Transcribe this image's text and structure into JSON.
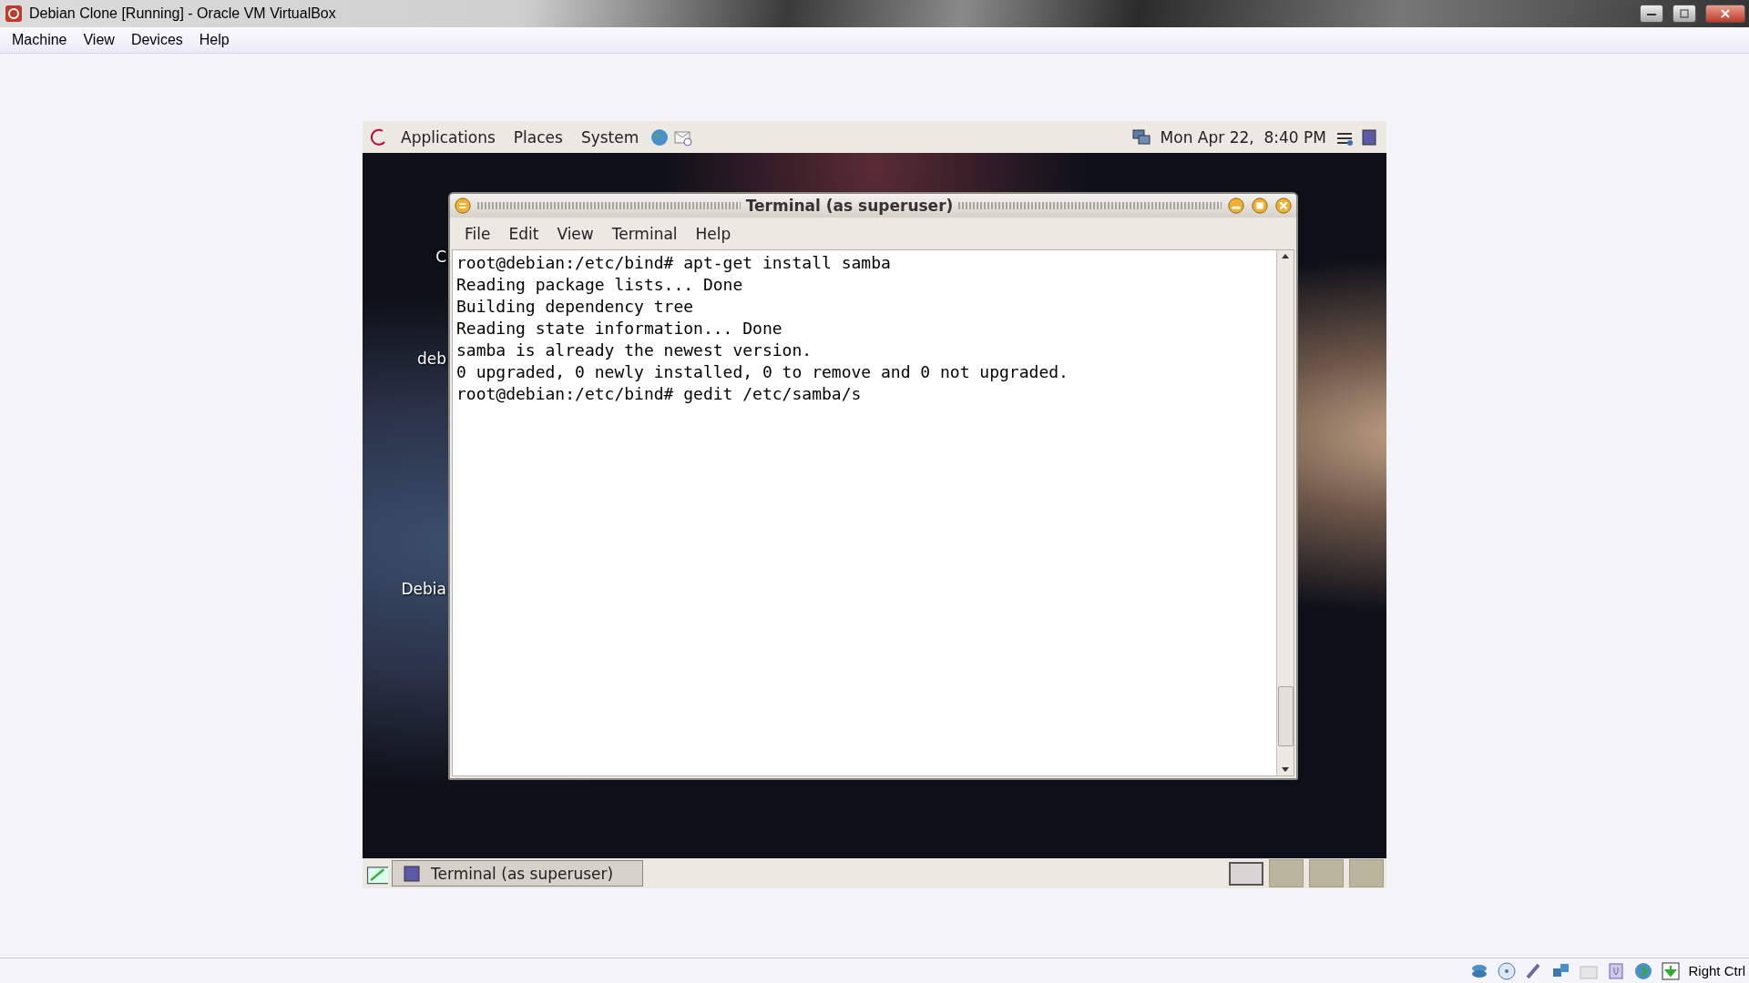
{
  "window": {
    "title": "Debian Clone [Running] - Oracle VM VirtualBox"
  },
  "menu": [
    "Machine",
    "View",
    "Devices",
    "Help"
  ],
  "guest": {
    "top_panel": {
      "menus": [
        "Applications",
        "Places",
        "System"
      ],
      "clock": "Mon Apr 22,  8:40 PM"
    },
    "desktop_icons": [
      "C",
      "deb",
      "Debia"
    ],
    "terminal": {
      "title": "Terminal (as superuser)",
      "menu": [
        "File",
        "Edit",
        "View",
        "Terminal",
        "Help"
      ],
      "lines": [
        "root@debian:/etc/bind# apt-get install samba",
        "Reading package lists... Done",
        "Building dependency tree",
        "Reading state information... Done",
        "samba is already the newest version.",
        "0 upgraded, 0 newly installed, 0 to remove and 0 not upgraded.",
        "root@debian:/etc/bind# gedit /etc/samba/s"
      ]
    },
    "bottom_panel": {
      "task": "Terminal (as superuser)",
      "workspaces": [
        {
          "selected": true
        },
        {
          "selected": false
        },
        {
          "selected": false
        },
        {
          "selected": false
        }
      ]
    }
  },
  "status_bar": {
    "host_key": "Right Ctrl"
  }
}
